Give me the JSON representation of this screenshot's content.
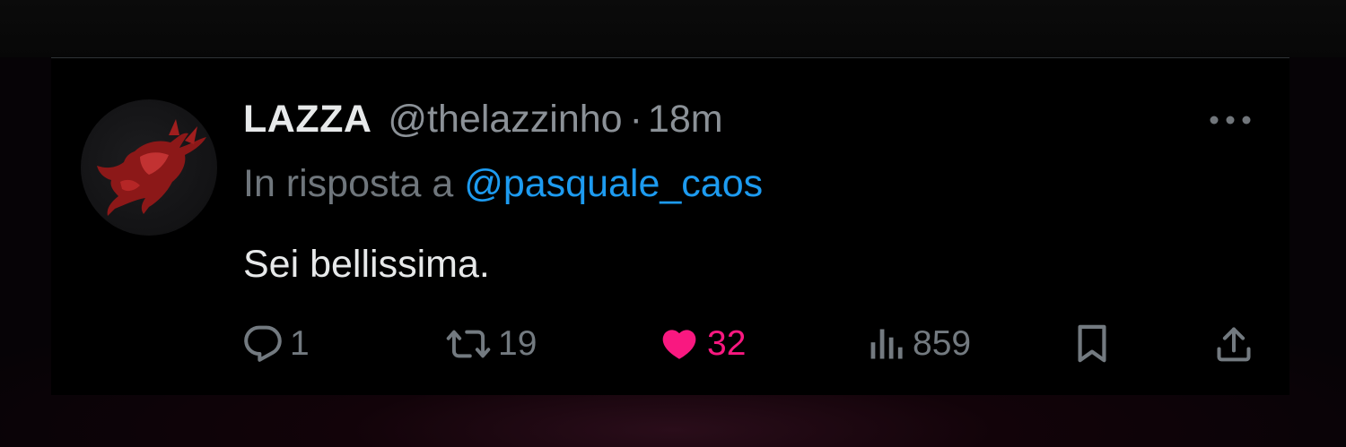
{
  "tweet": {
    "author": {
      "display_name": "LAZZA",
      "handle": "@thelazzinho",
      "avatar_icon": "red-bull-avatar"
    },
    "separator": "·",
    "time": "18m",
    "reply_to": {
      "prefix": "In risposta a",
      "mention": "@pasquale_caos"
    },
    "text": "Sei bellissima.",
    "actions": {
      "reply": {
        "icon": "reply-icon",
        "count": "1"
      },
      "retweet": {
        "icon": "retweet-icon",
        "count": "19"
      },
      "like": {
        "icon": "heart-icon",
        "count": "32",
        "liked": true
      },
      "views": {
        "icon": "views-icon",
        "count": "859"
      },
      "bookmark": {
        "icon": "bookmark-icon"
      },
      "share": {
        "icon": "share-icon"
      }
    }
  },
  "colors": {
    "background": "#000000",
    "primary_text": "#e7e9ea",
    "secondary_text": "#8b9197",
    "mention": "#1d9bf0",
    "like": "#f91880",
    "divider": "#2f3336"
  }
}
